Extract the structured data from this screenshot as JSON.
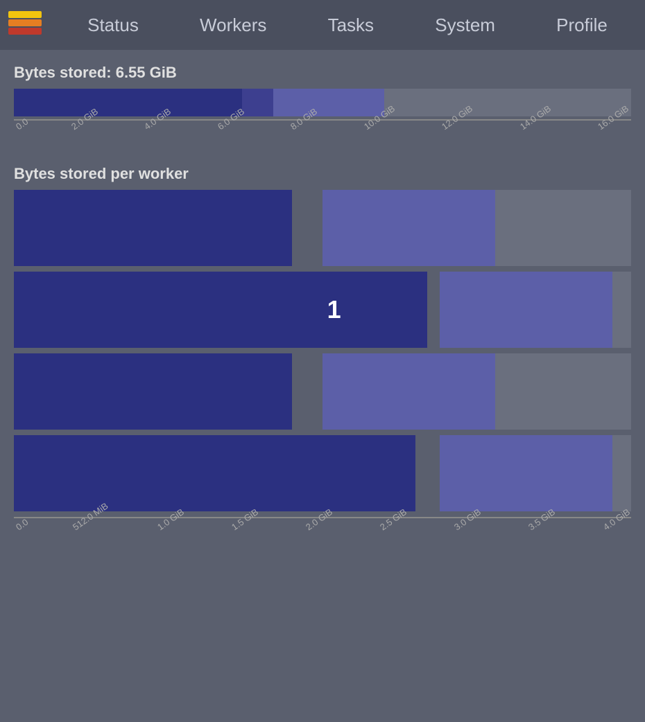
{
  "nav": {
    "items": [
      {
        "label": "Status",
        "id": "status"
      },
      {
        "label": "Workers",
        "id": "workers"
      },
      {
        "label": "Tasks",
        "id": "tasks"
      },
      {
        "label": "System",
        "id": "system"
      },
      {
        "label": "Profile",
        "id": "profile"
      }
    ]
  },
  "bytes_stored": {
    "title": "Bytes stored: 6.55 GiB",
    "x_axis": [
      "0.0",
      "2.0 GiB",
      "4.0 GiB",
      "6.0 GiB",
      "8.0 GiB",
      "10.0 GiB",
      "12.0 GiB",
      "14.0 GiB",
      "16.0 GiB"
    ],
    "bar": {
      "dark_pct": 37,
      "medium_pct": 5,
      "light_pct": 18
    }
  },
  "bytes_per_worker": {
    "title": "Bytes stored per worker",
    "number_label": "1",
    "bars": [
      {
        "dark_pct": 45,
        "gap_pct": 5,
        "light_pct": 28
      },
      {
        "dark_pct": 67,
        "gap_pct": 2,
        "light_pct": 28
      },
      {
        "dark_pct": 45,
        "gap_pct": 5,
        "light_pct": 28
      },
      {
        "dark_pct": 65,
        "gap_pct": 4,
        "light_pct": 28
      }
    ],
    "x_axis": [
      "0.0",
      "512.0 MiB",
      "1.0 GiB",
      "1.5 GiB",
      "2.0 GiB",
      "2.5 GiB",
      "3.0 GiB",
      "3.5 GiB",
      "4.0 GiB"
    ]
  }
}
